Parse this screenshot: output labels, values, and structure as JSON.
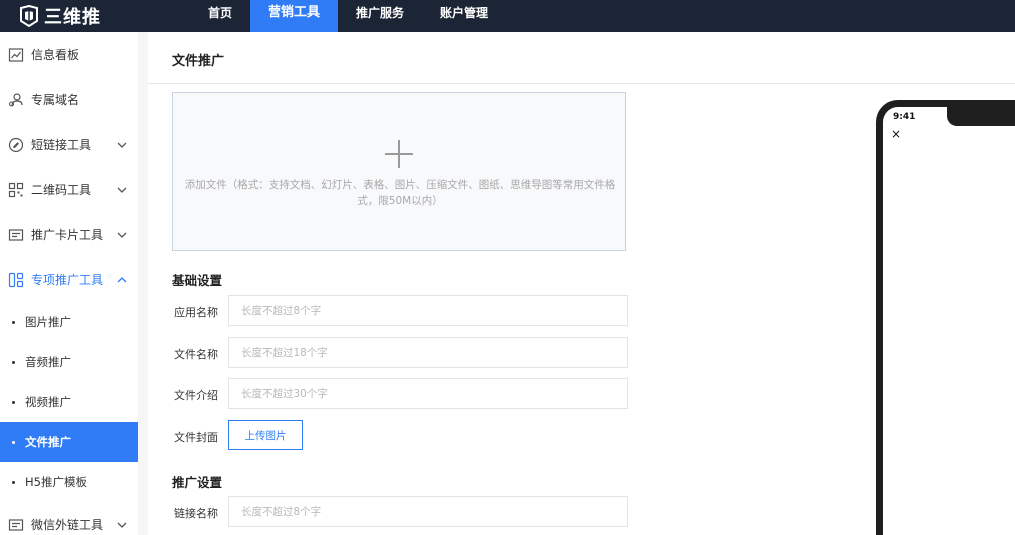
{
  "header": {
    "logo_text": "三维推",
    "nav": [
      {
        "label": "首页",
        "active": false
      },
      {
        "label": "营销工具",
        "active": true
      },
      {
        "label": "推广服务",
        "active": false
      },
      {
        "label": "账户管理",
        "active": false
      }
    ]
  },
  "sidebar": {
    "items": [
      {
        "label": "信息看板",
        "icon": "chart-icon"
      },
      {
        "label": "专属域名",
        "icon": "user-link-icon"
      },
      {
        "label": "短链接工具",
        "icon": "paperclip-icon"
      },
      {
        "label": "二维码工具",
        "icon": "qrcode-icon"
      },
      {
        "label": "推广卡片工具",
        "icon": "card-icon"
      },
      {
        "label": "专项推广工具",
        "icon": "grid-icon"
      }
    ],
    "sub_items": [
      {
        "label": "图片推广",
        "active": false
      },
      {
        "label": "音频推广",
        "active": false
      },
      {
        "label": "视频推广",
        "active": false
      },
      {
        "label": "文件推广",
        "active": true
      },
      {
        "label": "H5推广模板",
        "active": false
      }
    ],
    "last_item": {
      "label": "微信外链工具",
      "icon": "card-icon"
    }
  },
  "main": {
    "title": "文件推广",
    "upload_hint": "添加文件（格式：支持文档、幻灯片、表格、图片、压缩文件、图纸、思维导图等常用文件格式，限50M以内）",
    "basic_section": "基础设置",
    "fields": {
      "app_name": {
        "label": "应用名称",
        "placeholder": "长度不超过8个字"
      },
      "file_name": {
        "label": "文件名称",
        "placeholder": "长度不超过18个字"
      },
      "file_intro": {
        "label": "文件介绍",
        "placeholder": "长度不超过30个字"
      },
      "file_cover": {
        "label": "文件封面",
        "button": "上传图片"
      }
    },
    "promo_section": "推广设置",
    "link_name": {
      "label": "链接名称",
      "placeholder": "长度不超过8个字"
    }
  },
  "phone": {
    "time": "9:41",
    "close": "×"
  }
}
